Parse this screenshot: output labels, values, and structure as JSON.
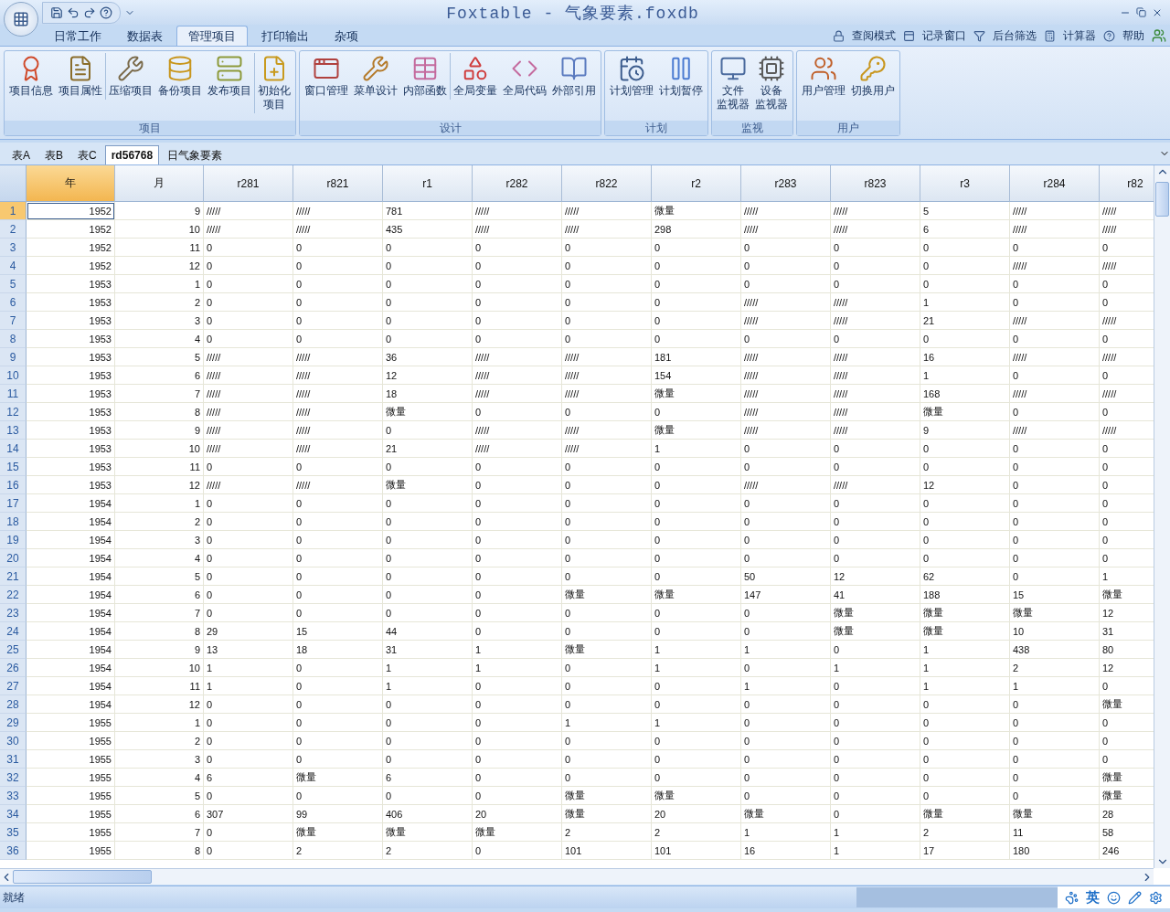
{
  "title": "Foxtable - 气象要素.foxdb",
  "ribbon_tabs": [
    {
      "label": "日常工作",
      "selected": false
    },
    {
      "label": "数据表",
      "selected": false
    },
    {
      "label": "管理项目",
      "selected": true
    },
    {
      "label": "打印输出",
      "selected": false
    },
    {
      "label": "杂项",
      "selected": false
    }
  ],
  "quick_links": [
    "查阅模式",
    "记录窗口",
    "后台筛选",
    "计算器",
    "帮助"
  ],
  "ribbon_groups": [
    {
      "label": "项目",
      "buttons": [
        {
          "lines": [
            "项目信息"
          ],
          "separated": false
        },
        {
          "lines": [
            "项目属性"
          ],
          "separated": false
        },
        {
          "lines": [
            "压缩项目"
          ],
          "separated": true
        },
        {
          "lines": [
            "备份项目"
          ],
          "separated": false
        },
        {
          "lines": [
            "发布项目"
          ],
          "separated": false
        },
        {
          "lines": [
            "初始化",
            "项目"
          ],
          "separated": true
        }
      ]
    },
    {
      "label": "设计",
      "buttons": [
        {
          "lines": [
            "窗口管理"
          ],
          "separated": false
        },
        {
          "lines": [
            "菜单设计"
          ],
          "separated": false
        },
        {
          "lines": [
            "内部函数"
          ],
          "separated": false
        },
        {
          "lines": [
            "全局变量"
          ],
          "separated": true
        },
        {
          "lines": [
            "全局代码"
          ],
          "separated": false
        },
        {
          "lines": [
            "外部引用"
          ],
          "separated": false
        }
      ]
    },
    {
      "label": "计划",
      "buttons": [
        {
          "lines": [
            "计划管理"
          ],
          "separated": false
        },
        {
          "lines": [
            "计划暂停"
          ],
          "separated": false
        }
      ]
    },
    {
      "label": "监视",
      "buttons": [
        {
          "lines": [
            "文件",
            "监视器"
          ],
          "separated": false
        },
        {
          "lines": [
            "设备",
            "监视器"
          ],
          "separated": false
        }
      ]
    },
    {
      "label": "用户",
      "buttons": [
        {
          "lines": [
            "用户管理"
          ],
          "separated": false
        },
        {
          "lines": [
            "切换用户"
          ],
          "separated": false
        }
      ]
    }
  ],
  "sheet_tabs": [
    {
      "label": "表A",
      "selected": false
    },
    {
      "label": "表B",
      "selected": false
    },
    {
      "label": "表C",
      "selected": false
    },
    {
      "label": "rd56768",
      "selected": true
    },
    {
      "label": "日气象要素",
      "selected": false
    }
  ],
  "table": {
    "columns": [
      {
        "name": "年",
        "kind": "key",
        "selected": true
      },
      {
        "name": "月",
        "kind": "key",
        "selected": false
      },
      {
        "name": "r281",
        "kind": "value",
        "selected": false
      },
      {
        "name": "r821",
        "kind": "value",
        "selected": false
      },
      {
        "name": "r1",
        "kind": "value",
        "selected": false
      },
      {
        "name": "r282",
        "kind": "value",
        "selected": false
      },
      {
        "name": "r822",
        "kind": "value",
        "selected": false
      },
      {
        "name": "r2",
        "kind": "value",
        "selected": false
      },
      {
        "name": "r283",
        "kind": "value",
        "selected": false
      },
      {
        "name": "r823",
        "kind": "value",
        "selected": false
      },
      {
        "name": "r3",
        "kind": "value",
        "selected": false
      },
      {
        "name": "r284",
        "kind": "value",
        "selected": false
      },
      {
        "name": "r82",
        "kind": "value",
        "selected": false
      }
    ],
    "rows": [
      {
        "number": "1",
        "selected": true,
        "cells": [
          "1952",
          "9",
          "/////",
          "/////",
          "781",
          "/////",
          "/////",
          "微量",
          "/////",
          "/////",
          "5",
          "/////",
          "/////"
        ]
      },
      {
        "number": "2",
        "selected": false,
        "cells": [
          "1952",
          "10",
          "/////",
          "/////",
          "435",
          "/////",
          "/////",
          "298",
          "/////",
          "/////",
          "6",
          "/////",
          "/////"
        ]
      },
      {
        "number": "3",
        "selected": false,
        "cells": [
          "1952",
          "11",
          "0",
          "0",
          "0",
          "0",
          "0",
          "0",
          "0",
          "0",
          "0",
          "0",
          "0"
        ]
      },
      {
        "number": "4",
        "selected": false,
        "cells": [
          "1952",
          "12",
          "0",
          "0",
          "0",
          "0",
          "0",
          "0",
          "0",
          "0",
          "0",
          "/////",
          "/////"
        ]
      },
      {
        "number": "5",
        "selected": false,
        "cells": [
          "1953",
          "1",
          "0",
          "0",
          "0",
          "0",
          "0",
          "0",
          "0",
          "0",
          "0",
          "0",
          "0"
        ]
      },
      {
        "number": "6",
        "selected": false,
        "cells": [
          "1953",
          "2",
          "0",
          "0",
          "0",
          "0",
          "0",
          "0",
          "/////",
          "/////",
          "1",
          "0",
          "0"
        ]
      },
      {
        "number": "7",
        "selected": false,
        "cells": [
          "1953",
          "3",
          "0",
          "0",
          "0",
          "0",
          "0",
          "0",
          "/////",
          "/////",
          "21",
          "/////",
          "/////"
        ]
      },
      {
        "number": "8",
        "selected": false,
        "cells": [
          "1953",
          "4",
          "0",
          "0",
          "0",
          "0",
          "0",
          "0",
          "0",
          "0",
          "0",
          "0",
          "0"
        ]
      },
      {
        "number": "9",
        "selected": false,
        "cells": [
          "1953",
          "5",
          "/////",
          "/////",
          "36",
          "/////",
          "/////",
          "181",
          "/////",
          "/////",
          "16",
          "/////",
          "/////"
        ]
      },
      {
        "number": "10",
        "selected": false,
        "cells": [
          "1953",
          "6",
          "/////",
          "/////",
          "12",
          "/////",
          "/////",
          "154",
          "/////",
          "/////",
          "1",
          "0",
          "0"
        ]
      },
      {
        "number": "11",
        "selected": false,
        "cells": [
          "1953",
          "7",
          "/////",
          "/////",
          "18",
          "/////",
          "/////",
          "微量",
          "/////",
          "/////",
          "168",
          "/////",
          "/////"
        ]
      },
      {
        "number": "12",
        "selected": false,
        "cells": [
          "1953",
          "8",
          "/////",
          "/////",
          "微量",
          "0",
          "0",
          "0",
          "/////",
          "/////",
          "微量",
          "0",
          "0"
        ]
      },
      {
        "number": "13",
        "selected": false,
        "cells": [
          "1953",
          "9",
          "/////",
          "/////",
          "0",
          "/////",
          "/////",
          "微量",
          "/////",
          "/////",
          "9",
          "/////",
          "/////"
        ]
      },
      {
        "number": "14",
        "selected": false,
        "cells": [
          "1953",
          "10",
          "/////",
          "/////",
          "21",
          "/////",
          "/////",
          "1",
          "0",
          "0",
          "0",
          "0",
          "0"
        ]
      },
      {
        "number": "15",
        "selected": false,
        "cells": [
          "1953",
          "11",
          "0",
          "0",
          "0",
          "0",
          "0",
          "0",
          "0",
          "0",
          "0",
          "0",
          "0"
        ]
      },
      {
        "number": "16",
        "selected": false,
        "cells": [
          "1953",
          "12",
          "/////",
          "/////",
          "微量",
          "0",
          "0",
          "0",
          "/////",
          "/////",
          "12",
          "0",
          "0"
        ]
      },
      {
        "number": "17",
        "selected": false,
        "cells": [
          "1954",
          "1",
          "0",
          "0",
          "0",
          "0",
          "0",
          "0",
          "0",
          "0",
          "0",
          "0",
          "0"
        ]
      },
      {
        "number": "18",
        "selected": false,
        "cells": [
          "1954",
          "2",
          "0",
          "0",
          "0",
          "0",
          "0",
          "0",
          "0",
          "0",
          "0",
          "0",
          "0"
        ]
      },
      {
        "number": "19",
        "selected": false,
        "cells": [
          "1954",
          "3",
          "0",
          "0",
          "0",
          "0",
          "0",
          "0",
          "0",
          "0",
          "0",
          "0",
          "0"
        ]
      },
      {
        "number": "20",
        "selected": false,
        "cells": [
          "1954",
          "4",
          "0",
          "0",
          "0",
          "0",
          "0",
          "0",
          "0",
          "0",
          "0",
          "0",
          "0"
        ]
      },
      {
        "number": "21",
        "selected": false,
        "cells": [
          "1954",
          "5",
          "0",
          "0",
          "0",
          "0",
          "0",
          "0",
          "50",
          "12",
          "62",
          "0",
          "1"
        ]
      },
      {
        "number": "22",
        "selected": false,
        "cells": [
          "1954",
          "6",
          "0",
          "0",
          "0",
          "0",
          "微量",
          "微量",
          "147",
          "41",
          "188",
          "15",
          "微量"
        ]
      },
      {
        "number": "23",
        "selected": false,
        "cells": [
          "1954",
          "7",
          "0",
          "0",
          "0",
          "0",
          "0",
          "0",
          "0",
          "微量",
          "微量",
          "微量",
          "12"
        ]
      },
      {
        "number": "24",
        "selected": false,
        "cells": [
          "1954",
          "8",
          "29",
          "15",
          "44",
          "0",
          "0",
          "0",
          "0",
          "微量",
          "微量",
          "10",
          "31"
        ]
      },
      {
        "number": "25",
        "selected": false,
        "cells": [
          "1954",
          "9",
          "13",
          "18",
          "31",
          "1",
          "微量",
          "1",
          "1",
          "0",
          "1",
          "438",
          "80"
        ]
      },
      {
        "number": "26",
        "selected": false,
        "cells": [
          "1954",
          "10",
          "1",
          "0",
          "1",
          "1",
          "0",
          "1",
          "0",
          "1",
          "1",
          "2",
          "12"
        ]
      },
      {
        "number": "27",
        "selected": false,
        "cells": [
          "1954",
          "11",
          "1",
          "0",
          "1",
          "0",
          "0",
          "0",
          "1",
          "0",
          "1",
          "1",
          "0"
        ]
      },
      {
        "number": "28",
        "selected": false,
        "cells": [
          "1954",
          "12",
          "0",
          "0",
          "0",
          "0",
          "0",
          "0",
          "0",
          "0",
          "0",
          "0",
          "微量"
        ]
      },
      {
        "number": "29",
        "selected": false,
        "cells": [
          "1955",
          "1",
          "0",
          "0",
          "0",
          "0",
          "1",
          "1",
          "0",
          "0",
          "0",
          "0",
          "0"
        ]
      },
      {
        "number": "30",
        "selected": false,
        "cells": [
          "1955",
          "2",
          "0",
          "0",
          "0",
          "0",
          "0",
          "0",
          "0",
          "0",
          "0",
          "0",
          "0"
        ]
      },
      {
        "number": "31",
        "selected": false,
        "cells": [
          "1955",
          "3",
          "0",
          "0",
          "0",
          "0",
          "0",
          "0",
          "0",
          "0",
          "0",
          "0",
          "0"
        ]
      },
      {
        "number": "32",
        "selected": false,
        "cells": [
          "1955",
          "4",
          "6",
          "微量",
          "6",
          "0",
          "0",
          "0",
          "0",
          "0",
          "0",
          "0",
          "微量"
        ]
      },
      {
        "number": "33",
        "selected": false,
        "cells": [
          "1955",
          "5",
          "0",
          "0",
          "0",
          "0",
          "微量",
          "微量",
          "0",
          "0",
          "0",
          "0",
          "微量"
        ]
      },
      {
        "number": "34",
        "selected": false,
        "cells": [
          "1955",
          "6",
          "307",
          "99",
          "406",
          "20",
          "微量",
          "20",
          "微量",
          "0",
          "微量",
          "微量",
          "28"
        ]
      },
      {
        "number": "35",
        "selected": false,
        "cells": [
          "1955",
          "7",
          "0",
          "微量",
          "微量",
          "微量",
          "2",
          "2",
          "1",
          "1",
          "2",
          "11",
          "58"
        ]
      },
      {
        "number": "36",
        "selected": false,
        "cells": [
          "1955",
          "8",
          "0",
          "2",
          "2",
          "0",
          "101",
          "101",
          "16",
          "1",
          "17",
          "180",
          "246"
        ]
      }
    ]
  },
  "status_bar": {
    "text": "就绪"
  },
  "tray": {
    "input_mode": "英"
  }
}
